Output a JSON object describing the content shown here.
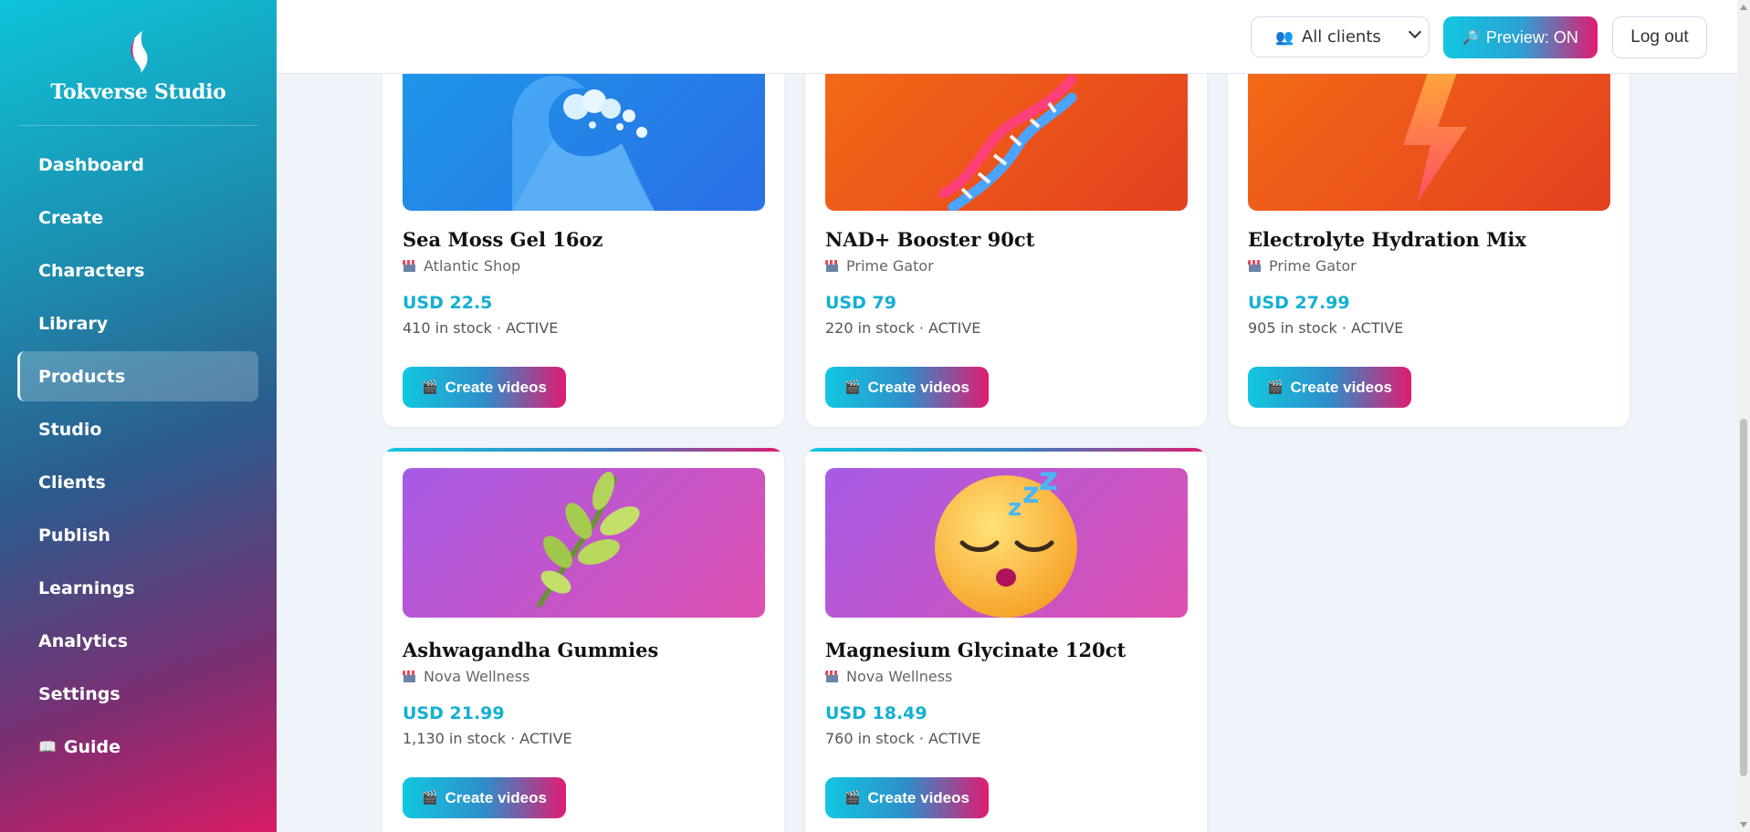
{
  "app": {
    "name": "Tokverse Studio"
  },
  "sidebar": {
    "items": [
      {
        "label": "Dashboard"
      },
      {
        "label": "Create"
      },
      {
        "label": "Characters"
      },
      {
        "label": "Library"
      },
      {
        "label": "Products",
        "active": true
      },
      {
        "label": "Studio"
      },
      {
        "label": "Clients"
      },
      {
        "label": "Publish"
      },
      {
        "label": "Learnings"
      },
      {
        "label": "Analytics"
      },
      {
        "label": "Settings"
      },
      {
        "label": "Guide",
        "icon": "book-icon"
      }
    ]
  },
  "header": {
    "client_filter": {
      "value": "All clients",
      "icon": "people-icon"
    },
    "preview_button": {
      "label": "Preview: ON",
      "icon": "magnifier-icon"
    },
    "logout_button": {
      "label": "Log out"
    }
  },
  "colors": {
    "accent_cyan": "#12c7e0",
    "accent_pink": "#e01c72",
    "price_color": "#12b0d2"
  },
  "products": [
    {
      "title": "Sea Moss Gel 16oz",
      "shop": "Atlantic Shop",
      "price": "USD 22.5",
      "stock": "410 in stock · ACTIVE",
      "image": "wave-icon",
      "button": "Create videos"
    },
    {
      "title": "NAD+ Booster 90ct",
      "shop": "Prime Gator",
      "price": "USD 79",
      "stock": "220 in stock · ACTIVE",
      "image": "dna-icon",
      "button": "Create videos"
    },
    {
      "title": "Electrolyte Hydration Mix",
      "shop": "Prime Gator",
      "price": "USD 27.99",
      "stock": "905 in stock · ACTIVE",
      "image": "lightning-icon",
      "button": "Create videos"
    },
    {
      "title": "Ashwagandha Gummies",
      "shop": "Nova Wellness",
      "price": "USD 21.99",
      "stock": "1,130 in stock · ACTIVE",
      "image": "herb-icon",
      "button": "Create videos"
    },
    {
      "title": "Magnesium Glycinate 120ct",
      "shop": "Nova Wellness",
      "price": "USD 18.49",
      "stock": "760 in stock · ACTIVE",
      "image": "sleeping-face-icon",
      "button": "Create videos"
    }
  ]
}
